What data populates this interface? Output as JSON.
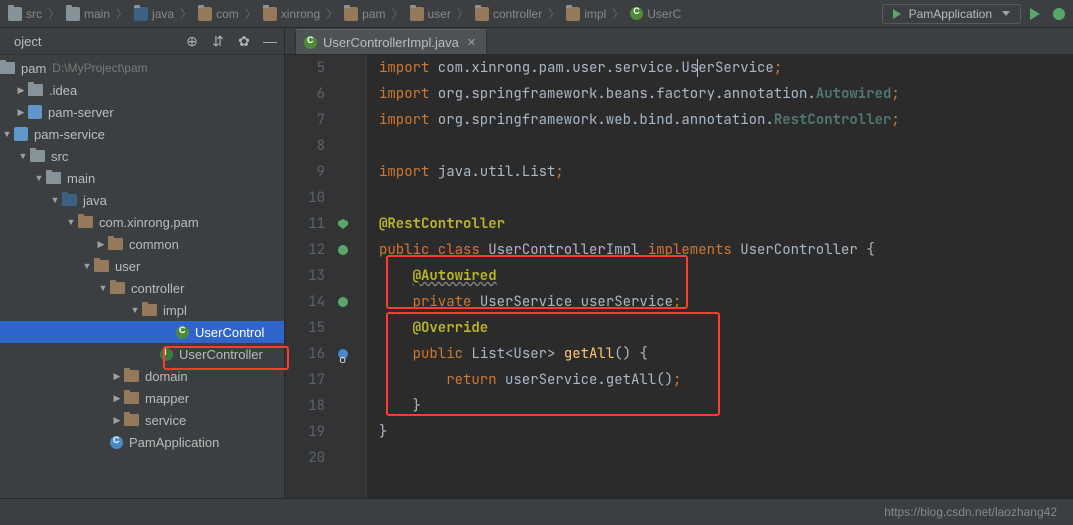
{
  "breadcrumbs": [
    "src",
    "main",
    "java",
    "com",
    "xinrong",
    "pam",
    "user",
    "controller",
    "impl",
    "UserC"
  ],
  "run_config": "PamApplication",
  "panel": {
    "title": "oject"
  },
  "project_root": {
    "name": "pam",
    "path": "D:\\MyProject\\pam"
  },
  "tree": {
    "idea": ".idea",
    "pam_server": "pam-server",
    "pam_service": "pam-service",
    "src": "src",
    "main": "main",
    "java": "java",
    "pkg": "com.xinrong.pam",
    "common": "common",
    "user": "user",
    "controller": "controller",
    "impl": "impl",
    "usercontrol_impl": "UserControl",
    "usercontroller": "UserController",
    "domain": "domain",
    "mapper": "mapper",
    "service": "service",
    "pamapp": "PamApplication"
  },
  "tab": {
    "title": "UserControllerImpl.java"
  },
  "code": {
    "lines": [
      5,
      6,
      7,
      8,
      9,
      10,
      11,
      12,
      13,
      14,
      15,
      16,
      17,
      18,
      19,
      20
    ],
    "l5a": "import",
    "l5b": " com.xinrong.pam.user.service.Us",
    "l5c": "erService",
    "l6a": "import",
    "l6b": " org.springframework.beans.factory.annotation.",
    "l6c": "Autowired",
    "l7a": "import",
    "l7b": " org.springframework.web.bind.annotation.",
    "l7c": "RestController",
    "l9a": "import",
    "l9b": " java.util.List",
    "l11": "@RestController",
    "l12a": "public",
    "l12b": " class",
    "l12c": " UserControllerImpl ",
    "l12d": "implements",
    "l12e": " UserController {",
    "l13": "@Autowired",
    "l14a": "private",
    "l14b": " UserService userService",
    "l15": "@Override",
    "l16a": "public",
    "l16b": " List<User> ",
    "l16c": "getAll",
    "l16d": "() {",
    "l17a": "return",
    "l17b": " userService.getAll()",
    "l18": "}",
    "l19": "}"
  },
  "footer": {
    "url": "https://blog.csdn.net/laozhang42"
  }
}
